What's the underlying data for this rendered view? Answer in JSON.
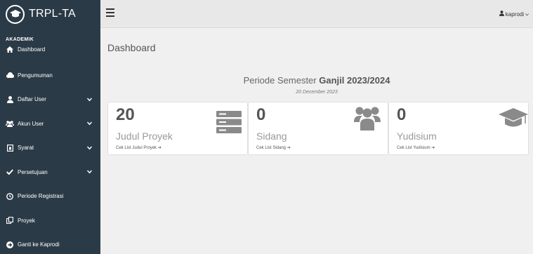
{
  "brand": {
    "title": "TRPL-TA",
    "logo_icon": "graduation-cap-icon"
  },
  "sidebar": {
    "section": "AKADEMIK",
    "items": [
      {
        "label": "Dashboard",
        "icon": "home-icon"
      },
      {
        "label": "Pengumuman",
        "icon": "cloud-icon"
      },
      {
        "label": "Daftar User",
        "icon": "user-icon",
        "has_submenu": true
      },
      {
        "label": "Akun User",
        "icon": "users-icon",
        "has_submenu": true
      },
      {
        "label": "Syarat",
        "icon": "file-icon",
        "has_submenu": true
      },
      {
        "label": "Persetujuan",
        "icon": "check-icon",
        "has_submenu": true
      },
      {
        "label": "Periode Registrasi",
        "icon": "clock-icon"
      },
      {
        "label": "Proyek",
        "icon": "copy-icon"
      },
      {
        "label": "Ganti ke Kaprodi",
        "icon": "arrow-circle-icon"
      }
    ]
  },
  "topbar": {
    "user": "kaprodi"
  },
  "main": {
    "title": "Dashboard",
    "periode_prefix": "Periode Semester",
    "periode_value": "Ganjil 2023/2024",
    "date": "20 December 2023",
    "cards": [
      {
        "count": "20",
        "label": "Judul Proyek",
        "link": "Cek List Judul Proyek",
        "icon": "server-icon"
      },
      {
        "count": "0",
        "label": "Sidang",
        "link": "Cek List Sidang",
        "icon": "users-icon"
      },
      {
        "count": "0",
        "label": "Yudisium",
        "link": "Cek List Yudisium",
        "icon": "graduation-cap-icon"
      }
    ]
  },
  "colors": {
    "sidebar_bg": "#2b3a47",
    "topbar_bg": "#e8e8e8",
    "icon_gray": "#8a8a8a"
  }
}
